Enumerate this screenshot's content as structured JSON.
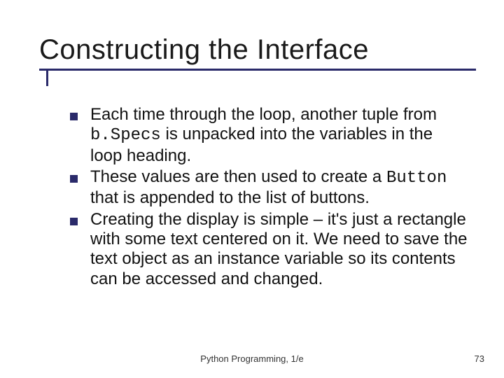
{
  "title": "Constructing the Interface",
  "bullets": [
    {
      "pre": "Each time through the loop, another tuple from ",
      "code": "b.Specs",
      "post": " is unpacked into the variables in the loop heading."
    },
    {
      "pre": "These values are then used to create a ",
      "code": "Button",
      "post": " that is appended to the list of buttons."
    },
    {
      "pre": "Creating the display is simple – it's just a rectangle with some text centered on it. We need to save the text object as an instance variable so its contents can be accessed and changed.",
      "code": "",
      "post": ""
    }
  ],
  "footer_center": "Python Programming, 1/e",
  "page_number": "73"
}
